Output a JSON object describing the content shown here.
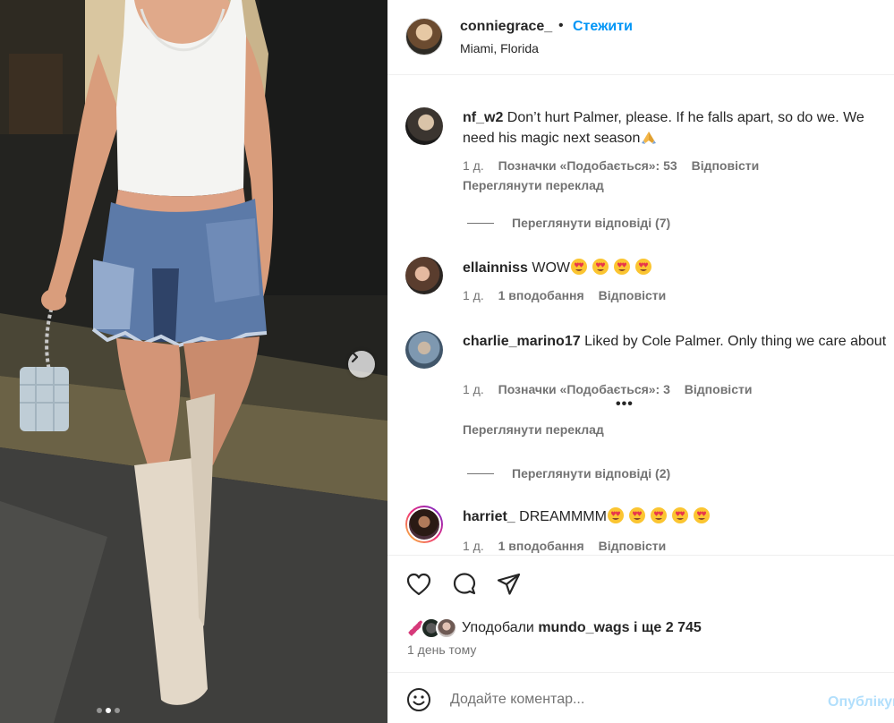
{
  "header": {
    "username": "conniegrace_",
    "separator": "•",
    "follow_label": "Стежити",
    "location": "Miami, Florida"
  },
  "comments": [
    {
      "username": "nf_w2",
      "text": "Don’t hurt Palmer, please. If he falls apart, so do we. We need his magic next season",
      "emoji_after": [
        "folded-hands"
      ],
      "time": "1 д.",
      "likes": "Позначки «Подобається»: 53",
      "reply": "Відповісти",
      "translate": "Переглянути переклад",
      "view_replies": "Переглянути відповіді (7)"
    },
    {
      "username": "ellainniss",
      "text": "WOW",
      "emoji_after": [
        "heart-eyes",
        "heart-eyes",
        "heart-eyes",
        "heart-eyes"
      ],
      "time": "1 д.",
      "likes": "1 вподобання",
      "reply": "Відповісти"
    },
    {
      "username": "charlie_marino17",
      "text": "Liked by Cole Palmer. Only thing we care about",
      "time": "1 д.",
      "likes": "Позначки «Подобається»: 3",
      "reply": "Відповісти",
      "more": "•••",
      "translate": "Переглянути переклад",
      "view_replies": "Переглянути відповіді (2)"
    },
    {
      "username": "harriet_",
      "text": "DREAMMMM",
      "emoji_after": [
        "heart-eyes",
        "heart-eyes",
        "heart-eyes",
        "heart-eyes",
        "heart-eyes"
      ],
      "time": "1 д.",
      "likes": "1 вподобання",
      "reply": "Відповісти"
    }
  ],
  "actions": {
    "icons": [
      "heart-icon",
      "comment-icon",
      "share-icon"
    ],
    "liked_by_prefix": "Уподобали",
    "liked_by_user": "mundo_wags",
    "liked_by_suffix": "і ще 2 745",
    "time_ago": "1 день тому"
  },
  "add_comment": {
    "placeholder": "Додайте коментар...",
    "publish_label": "Опублікувати"
  },
  "carousel": {
    "slide_count": 3,
    "active_slide": 2
  },
  "colors": {
    "accent": "#0095f6",
    "publish_disabled": "#b2dffc",
    "muted_text": "#737373",
    "story_ring_start": "#f9ce34",
    "story_ring_end": "#ee2a7b"
  }
}
